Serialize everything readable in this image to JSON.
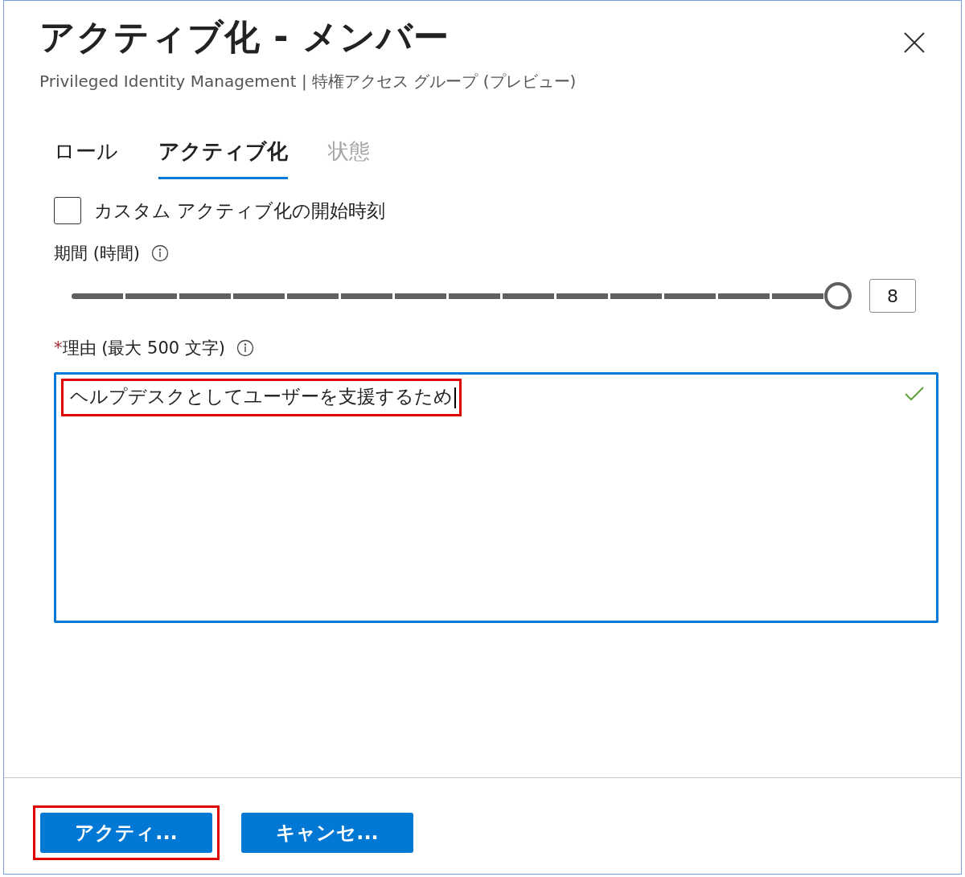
{
  "dialog": {
    "title": "アクティブ化 - メンバー",
    "subtitle": "Privileged Identity Management | 特権アクセス グループ (プレビュー)"
  },
  "tabs": [
    {
      "label": "ロール",
      "selected": false,
      "disabled": false
    },
    {
      "label": "アクティブ化",
      "selected": true,
      "disabled": false
    },
    {
      "label": "状態",
      "selected": false,
      "disabled": true
    }
  ],
  "custom_start": {
    "label": "カスタム アクティブ化の開始時刻",
    "checked": false
  },
  "duration": {
    "label": "期間 (時間)",
    "level": 1,
    "value": "8"
  },
  "reason": {
    "required_mark": "*",
    "label": "理由 (最大 500 文字)",
    "value": "ヘルプデスクとしてユーザーを支援するため",
    "valid": true,
    "highlighted": true
  },
  "buttons": [
    {
      "label": "アクティ...",
      "highlighted": true
    },
    {
      "label": "キャンセ...",
      "highlighted": false
    }
  ]
}
